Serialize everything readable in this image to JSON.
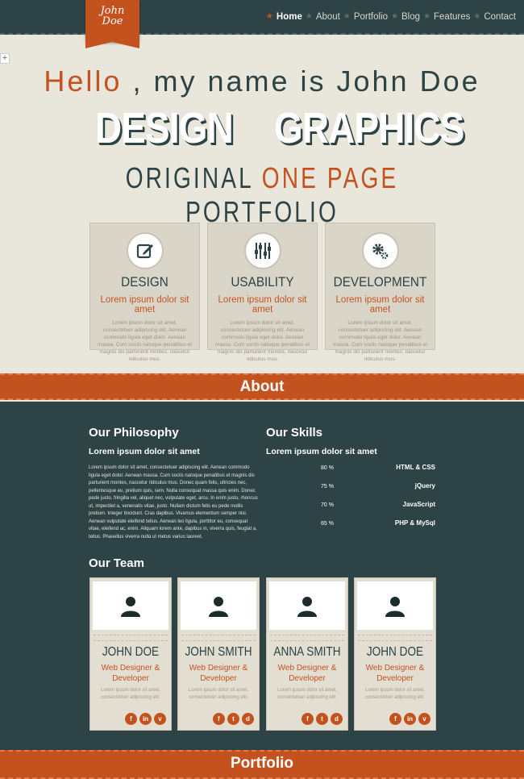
{
  "logo": {
    "line1": "John",
    "line2": "Doe"
  },
  "nav": {
    "items": [
      "Home",
      "About",
      "Portfolio",
      "Blog",
      "Features",
      "Contact"
    ]
  },
  "hero": {
    "hello_a": "Hello",
    "hello_b": ", my name is John Doe",
    "word1": "DESIGN",
    "word2": "GRAPHICS",
    "orig_a": "ORIGINAL",
    "orig_b": "ONE PAGE",
    "orig_c": "PORTFOLIO"
  },
  "features": [
    {
      "title": "DESIGN",
      "subtitle": "Lorem ipsum dolor sit amet",
      "icon": "edit-icon",
      "text": "Lorem ipsum dolor sit amet, consectetuer adipiscing elit. Aenean commodo ligula eget dolor. Aenean massa. Cum sociis natoque penatibus et magnis dis parturient montes, nascetur ridiculus mus."
    },
    {
      "title": "USABILITY",
      "subtitle": "Lorem ipsum dolor sit amet",
      "icon": "equalizer-icon",
      "text": "Lorem ipsum dolor sit amet, consectetuer adipiscing elit. Aenean commodo ligula eget dolor. Aenean massa. Cum sociis natoque penatibus et magnis dis parturient montes, nascetur ridiculus mus."
    },
    {
      "title": "DEVELOPMENT",
      "subtitle": "Lorem ipsum dolor sit amet",
      "icon": "gear-icon",
      "text": "Lorem ipsum dolor sit amet, consectetuer adipiscing elit. Aenean commodo ligula eget dolor. Aenean massa. Cum sociis natoque penatibus et magnis dis parturient montes, nascetur ridiculus mus."
    }
  ],
  "about": {
    "band": "About",
    "philosophy_title": "Our Philosophy",
    "philosophy_sub": "Lorem ipsum dolor sit amet",
    "philosophy_text": "Lorem ipsum dolor sit amet, consectetuer adipiscing elit. Aenean commodo ligula eget dolor. Aenean massa. Cum sociis natoque penatibus et magnis dis parturient montes, nascetur ridiculus mus. Donec quam felis, ultricies nec, pellentesque eu, pretium quis, sem. Nulla consequat massa quis enim. Donec pede justo, fringilla vel, aliquet nec, vulputate eget, arcu. In enim justo, rhoncus ut, imperdiet a, venenatis vitae, justo. Nullam dictum felis eu pede mollis pretium. Integer tincidunt. Cras dapibus. Vivamus elementum semper nisi. Aenean vulputate eleifend tellus. Aenean leo ligula, porttitor eu, consequat vitae, eleifend ac, enim. Aliquam lorem ante, dapibus in, viverra quis, feugiat a, tellus. Phasellus viverra nulla ut metus varius laoreet.",
    "skills_title": "Our Skills",
    "skills_sub": "Lorem ipsum dolor sit amet",
    "skills": [
      {
        "pct": "80 %",
        "name": "HTML & CSS"
      },
      {
        "pct": "75 %",
        "name": "jQuery"
      },
      {
        "pct": "70 %",
        "name": "JavaScript"
      },
      {
        "pct": "65 %",
        "name": "PHP & MySql"
      }
    ],
    "team_title": "Our Team"
  },
  "team": [
    {
      "name": "JOHN DOE",
      "role1": "Web Designer &",
      "role2": "Developer",
      "text": "Lorem ipsum dolor sit amet, consectetuer adipiscing elit.",
      "social": [
        "f",
        "in",
        "v"
      ]
    },
    {
      "name": "JOHN SMITH",
      "role1": "Web Designer &",
      "role2": "Developer",
      "text": "Lorem ipsum dolor sit amet, consectetuer adipiscing elit.",
      "social": [
        "f",
        "t",
        "d"
      ]
    },
    {
      "name": "ANNA SMITH",
      "role1": "Web Designer &",
      "role2": "Developer",
      "text": "Lorem ipsum dolor sit amet, consectetuer adipiscing elit.",
      "social": [
        "f",
        "t",
        "d"
      ]
    },
    {
      "name": "JOHN DOE",
      "role1": "Web Designer &",
      "role2": "Developer",
      "text": "Lorem ipsum dolor sit amet, consectetuer adipiscing elit.",
      "social": [
        "f",
        "in",
        "v"
      ]
    }
  ],
  "portfolio": {
    "band": "Portfolio"
  },
  "colors": {
    "accent": "#c4521f",
    "dark": "#2d4345",
    "background": "#e9e6dc"
  }
}
